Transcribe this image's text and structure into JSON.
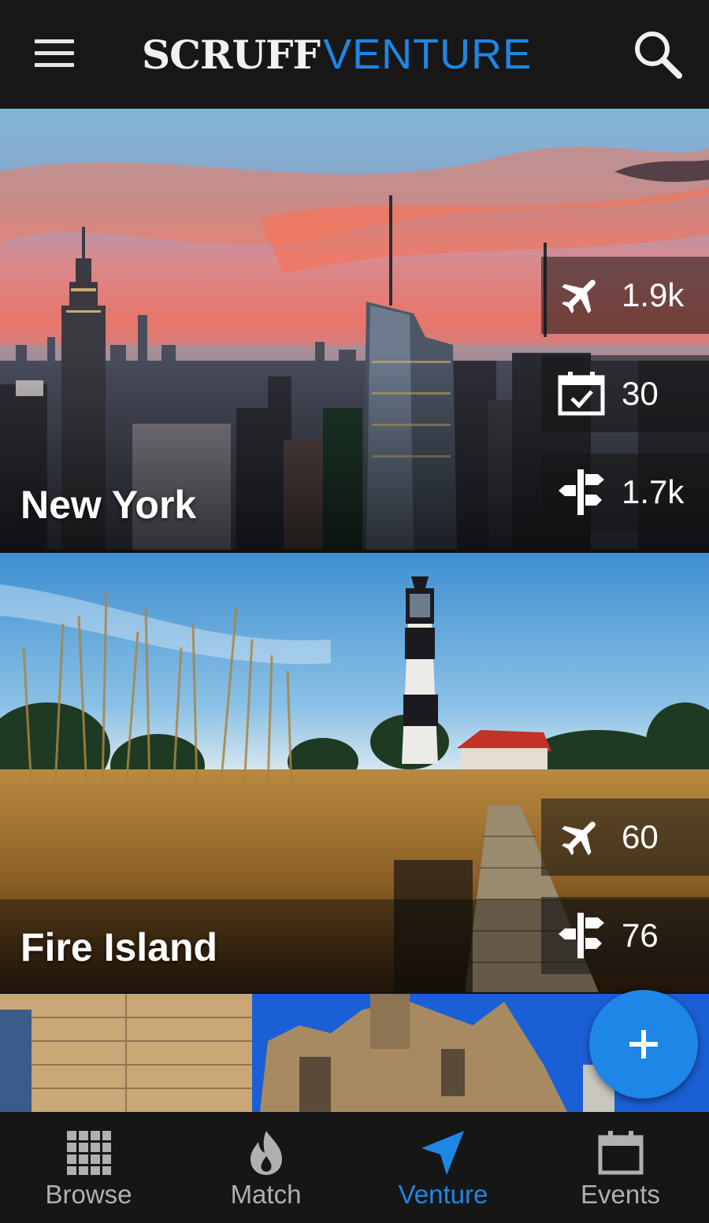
{
  "header": {
    "logo_part1": "SCRUFF",
    "logo_part2": "VENTURE"
  },
  "colors": {
    "accent": "#1e86e6",
    "header_bg": "#171717",
    "nav_inactive": "#b0b0b0"
  },
  "cards": [
    {
      "title": "New York",
      "stats": [
        {
          "icon": "airplane-icon",
          "value": "1.9k"
        },
        {
          "icon": "calendar-check-icon",
          "value": "30"
        },
        {
          "icon": "signpost-icon",
          "value": "1.7k"
        }
      ]
    },
    {
      "title": "Fire Island",
      "stats": [
        {
          "icon": "airplane-icon",
          "value": "60"
        },
        {
          "icon": "signpost-icon",
          "value": "76"
        }
      ]
    }
  ],
  "fab": {
    "icon": "plus-icon"
  },
  "bottom_nav": {
    "items": [
      {
        "label": "Browse",
        "icon": "grid-icon",
        "active": false
      },
      {
        "label": "Match",
        "icon": "flame-icon",
        "active": false
      },
      {
        "label": "Venture",
        "icon": "navigation-arrow-icon",
        "active": true
      },
      {
        "label": "Events",
        "icon": "calendar-icon",
        "active": false
      }
    ]
  }
}
